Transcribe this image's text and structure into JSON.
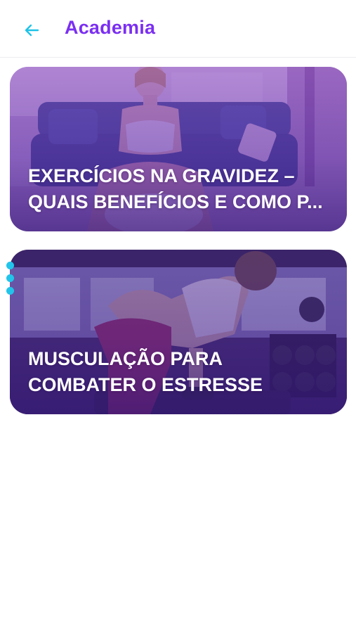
{
  "header": {
    "title": "Academia",
    "back_icon": "arrow-left-icon"
  },
  "colors": {
    "title_purple": "#7b2ff2",
    "back_arrow_cyan": "#1fc3e8",
    "card_overlay_purple": "#5b2aa8",
    "card_overlay_dark": "#3a1c78",
    "pager_dot_cyan": "#22c4ea"
  },
  "articles": [
    {
      "title_line1": "EXERCÍCIOS NA GRAVIDEZ –",
      "title_line2": "QUAIS BENEFÍCIOS E COMO P..."
    },
    {
      "title_line1": "MUSCULAÇÃO PARA",
      "title_line2": "COMBATER O ESTRESSE"
    }
  ]
}
